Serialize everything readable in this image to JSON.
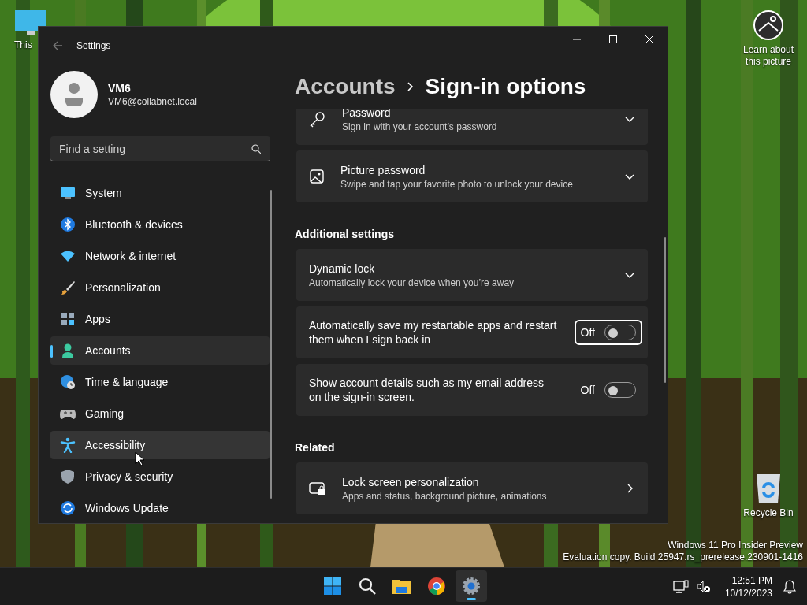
{
  "desktop": {
    "icons": [
      {
        "label": "This"
      },
      {
        "label": "Recycle Bin"
      }
    ],
    "spotlight": {
      "label": "Learn about this picture"
    },
    "build_info": [
      "Windows 11 Pro Insider Preview",
      "Evaluation copy. Build 25947.rs_prerelease.230901-1416"
    ]
  },
  "window": {
    "title": "Settings"
  },
  "account": {
    "name": "VM6",
    "email": "VM6@collabnet.local"
  },
  "search": {
    "placeholder": "Find a setting"
  },
  "nav": [
    {
      "label": "System",
      "selected": false,
      "hovered": false
    },
    {
      "label": "Bluetooth & devices",
      "selected": false,
      "hovered": false
    },
    {
      "label": "Network & internet",
      "selected": false,
      "hovered": false
    },
    {
      "label": "Personalization",
      "selected": false,
      "hovered": false
    },
    {
      "label": "Apps",
      "selected": false,
      "hovered": false
    },
    {
      "label": "Accounts",
      "selected": true,
      "hovered": false
    },
    {
      "label": "Time & language",
      "selected": false,
      "hovered": false
    },
    {
      "label": "Gaming",
      "selected": false,
      "hovered": false
    },
    {
      "label": "Accessibility",
      "selected": false,
      "hovered": true
    },
    {
      "label": "Privacy & security",
      "selected": false,
      "hovered": false
    },
    {
      "label": "Windows Update",
      "selected": false,
      "hovered": false
    }
  ],
  "breadcrumb": {
    "parent": "Accounts",
    "current": "Sign-in options"
  },
  "sections": [
    {
      "items": [
        {
          "kind": "expander",
          "title": "Password",
          "subtitle": "Sign in with your account’s password"
        },
        {
          "kind": "expander",
          "title": "Picture password",
          "subtitle": "Swipe and tap your favorite photo to unlock your device"
        }
      ]
    },
    {
      "heading": "Additional settings",
      "items": [
        {
          "kind": "expander",
          "title": "Dynamic lock",
          "subtitle": "Automatically lock your device when you’re away"
        },
        {
          "kind": "toggle",
          "title": "Automatically save my restartable apps and restart them when I sign back in",
          "state": "Off",
          "on": false,
          "focused": true
        },
        {
          "kind": "toggle",
          "title": "Show account details such as my email address on the sign-in screen.",
          "state": "Off",
          "on": false,
          "focused": false
        }
      ]
    },
    {
      "heading": "Related",
      "items": [
        {
          "kind": "link",
          "title": "Lock screen personalization",
          "subtitle": "Apps and status, background picture, animations"
        }
      ]
    }
  ],
  "taskbar": {
    "apps": [
      {
        "active": false
      },
      {
        "active": false
      },
      {
        "active": false
      },
      {
        "active": false
      },
      {
        "active": true
      }
    ],
    "time": "12:51 PM",
    "date": "10/12/2023"
  }
}
